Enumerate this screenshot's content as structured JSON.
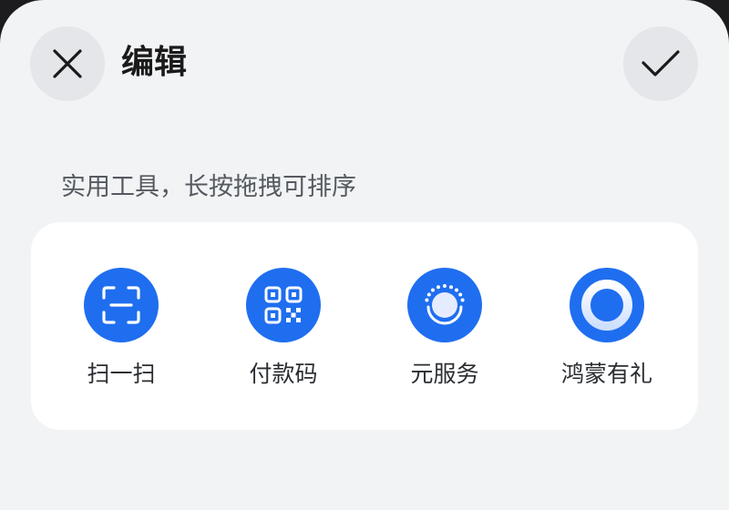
{
  "header": {
    "title": "编辑",
    "close_icon": "close-icon",
    "confirm_icon": "check-icon"
  },
  "section": {
    "label": "实用工具，长按拖拽可排序"
  },
  "tools": [
    {
      "label": "扫一扫",
      "icon": "scan-icon"
    },
    {
      "label": "付款码",
      "icon": "payment-code-icon"
    },
    {
      "label": "元服务",
      "icon": "atomic-service-icon"
    },
    {
      "label": "鸿蒙有礼",
      "icon": "harmony-gift-icon"
    }
  ],
  "colors": {
    "accent": "#1f6ef0",
    "background": "#f1f3f5",
    "card": "#ffffff",
    "button": "#e4e6e9"
  }
}
